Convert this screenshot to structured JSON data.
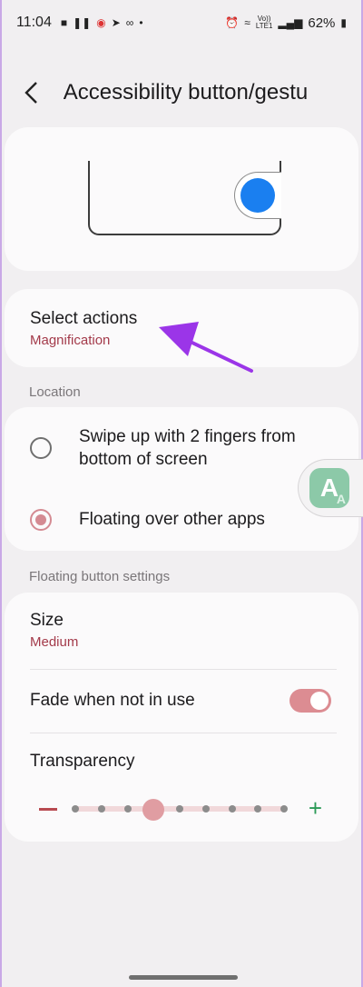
{
  "status_bar": {
    "time": "11:04",
    "battery": "62%",
    "volte_line1": "Vo))",
    "volte_line2": "LTE1"
  },
  "header": {
    "title": "Accessibility button/gestu"
  },
  "select_actions": {
    "title": "Select actions",
    "value": "Magnification"
  },
  "location": {
    "section_label": "Location",
    "options": [
      {
        "label": "Swipe up with 2 fingers from bottom of screen",
        "selected": false
      },
      {
        "label": "Floating over other apps",
        "selected": true
      }
    ]
  },
  "floating_settings": {
    "section_label": "Floating button settings",
    "size": {
      "title": "Size",
      "value": "Medium"
    },
    "fade": {
      "title": "Fade when not in use",
      "enabled": true
    },
    "transparency": {
      "title": "Transparency",
      "steps": 9,
      "current_step": 3
    }
  },
  "colors": {
    "accent": "#dc8c92",
    "subtitle": "#a33a4a",
    "preview_dot": "#1a7ff0",
    "plus": "#2c9a57"
  }
}
